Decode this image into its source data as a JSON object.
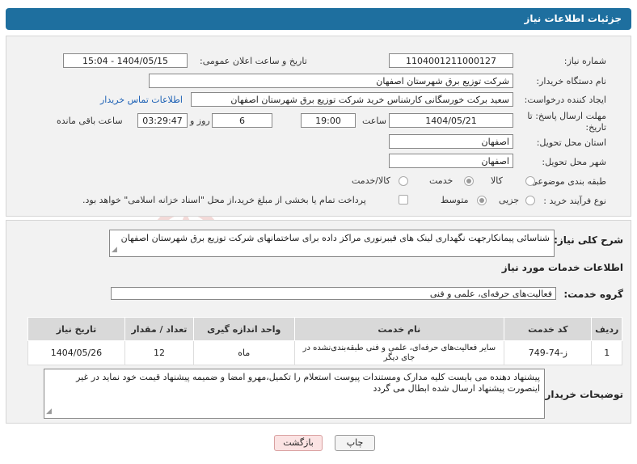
{
  "header": {
    "title": "جزئیات اطلاعات نیاز"
  },
  "form": {
    "need_number_label": "شماره نیاز:",
    "need_number": "1104001211000127",
    "announce_label": "تاریخ و ساعت اعلان عمومی:",
    "announce_value": "1404/05/15 - 15:04",
    "buyer_org_label": "نام دستگاه خریدار:",
    "buyer_org": "شرکت توزیع برق شهرستان اصفهان",
    "creator_label": "ایجاد کننده درخواست:",
    "creator": "سعید برکت خورسگانی کارشناس خرید شرکت توزیع برق شهرستان اصفهان",
    "contact_link": "اطلاعات تماس خریدار",
    "deadline_label": "مهلت ارسال پاسخ: تا تاریخ:",
    "deadline_date": "1404/05/21",
    "time_label": "ساعت",
    "deadline_time": "19:00",
    "days": "6",
    "days_label": "روز و",
    "remaining": "03:29:47",
    "remaining_label": "ساعت باقی مانده",
    "province_label": "استان محل تحویل:",
    "province": "اصفهان",
    "city_label": "شهر محل تحویل:",
    "city": "اصفهان",
    "category_label": "طبقه بندی موضوعی:",
    "category_options": [
      "کالا",
      "خدمت",
      "کالا/خدمت"
    ],
    "process_label": "نوع فرآیند خرید :",
    "process_options": [
      "جزیی",
      "متوسط"
    ],
    "payment_note": "پرداخت تمام یا بخشی از مبلغ خرید،از محل \"اسناد خزانه اسلامی\" خواهد بود."
  },
  "summary": {
    "label": "شرح کلی نیاز:",
    "text": "شناسائی پیمانکارجهت نگهداری لینک های فیبرنوری مراکز داده برای ساختمانهای شرکت توزیع برق شهرستان اصفهان"
  },
  "services": {
    "section_title": "اطلاعات خدمات مورد نیاز",
    "group_label": "گروه خدمت:",
    "group_value": "فعالیت‌های حرفه‌ای، علمی و فنی",
    "columns": [
      "ردیف",
      "کد خدمت",
      "نام خدمت",
      "واحد اندازه گیری",
      "تعداد / مقدار",
      "تاریخ نیاز"
    ],
    "rows": [
      {
        "index": "1",
        "code": "ز-74-749",
        "name": "سایر فعالیت‌های حرفه‌ای، علمی و فنی طبقه‌بندی‌نشده در جای دیگر",
        "unit": "ماه",
        "qty": "12",
        "date": "1404/05/26"
      }
    ]
  },
  "buyer_notes": {
    "label": "توضیحات خریدار:",
    "text": "پیشنهاد دهنده می بایست کلیه مدارک ومستندات پیوست استعلام را تکمیل،مهرو امضا و ضمیمه پیشنهاد قیمت خود نماید در غیر اینصورت پیشنهاد ارسال شده ابطال می گردد"
  },
  "buttons": {
    "print": "چاپ",
    "back": "بازگشت"
  },
  "colors": {
    "header": "#1e6f9f",
    "panel": "#f2f2f2",
    "link": "#1a5fb4",
    "back_button": "#fbe3e3"
  }
}
